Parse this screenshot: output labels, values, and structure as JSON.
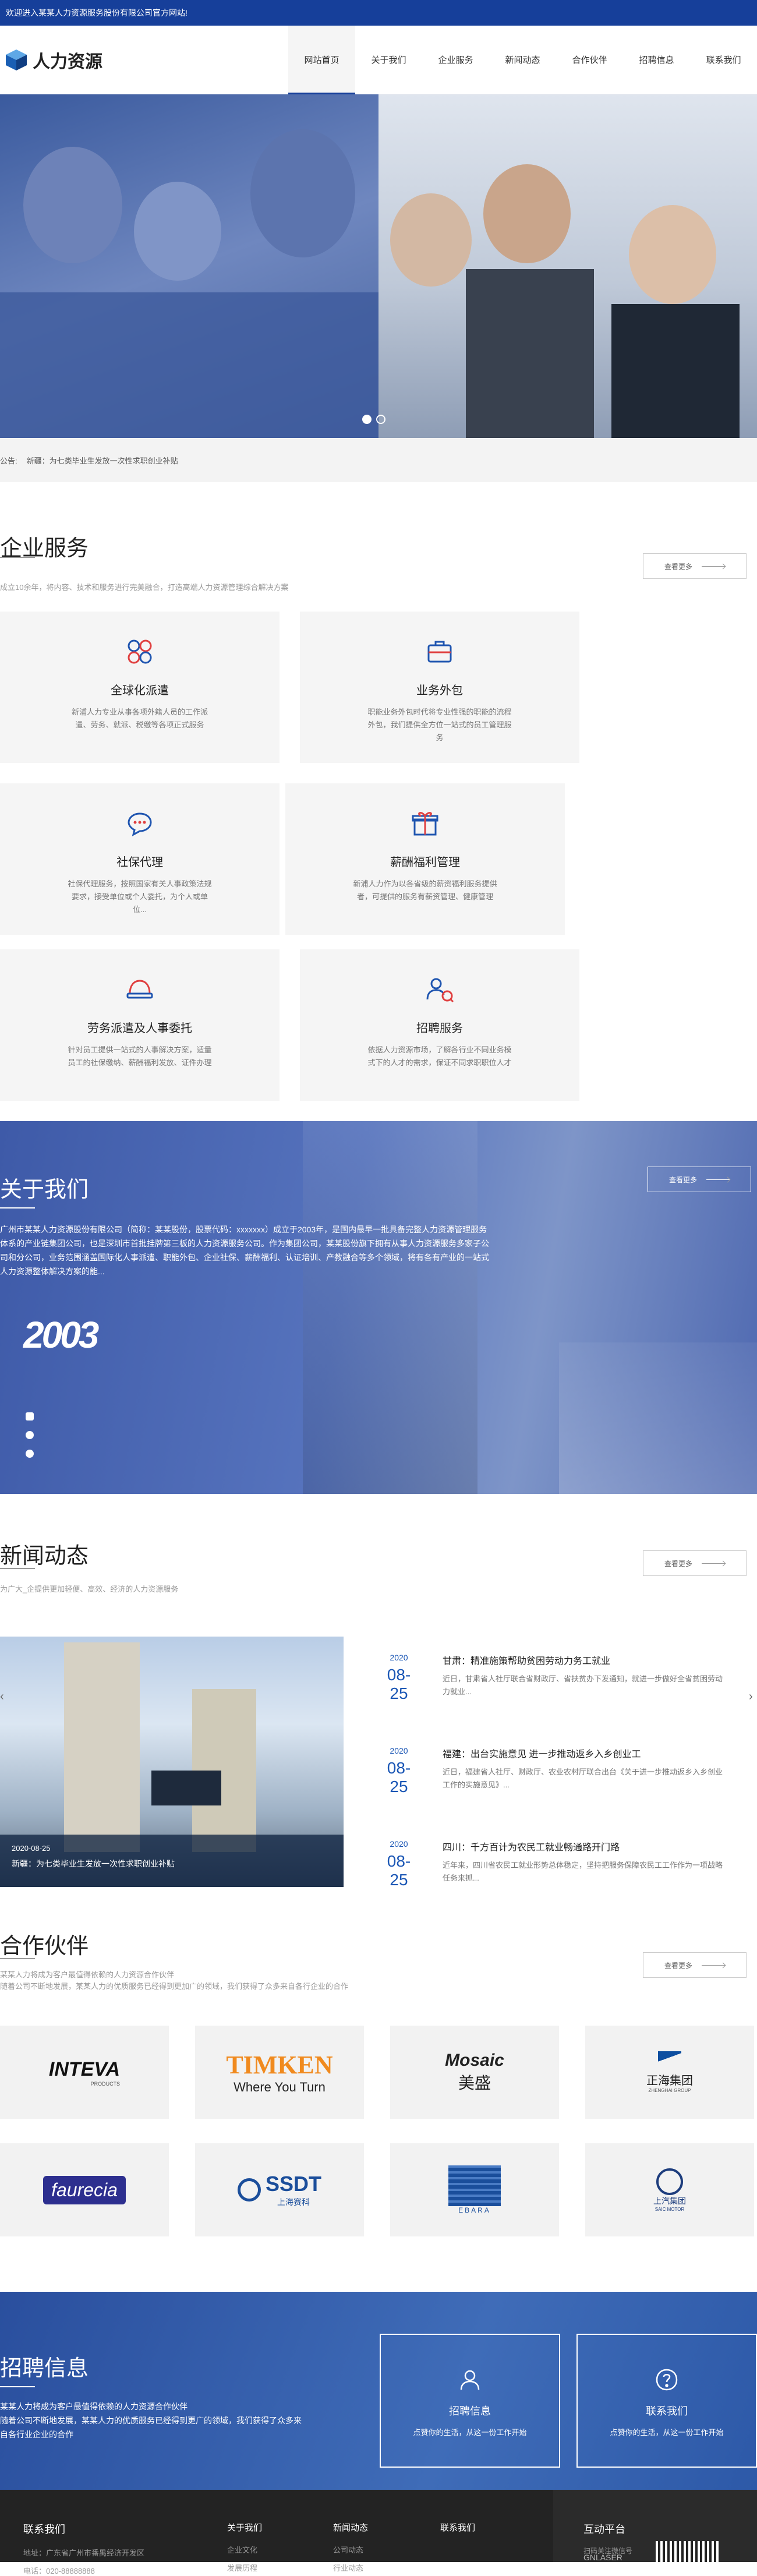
{
  "topbar": {
    "welcome": "欢迎进入某某人力资源服务股份有限公司官方网站!"
  },
  "header": {
    "logo_text": "人力资源",
    "nav": [
      "网站首页",
      "关于我们",
      "企业服务",
      "新闻动态",
      "合作伙伴",
      "招聘信息",
      "联系我们"
    ]
  },
  "notice": {
    "label": "公告:",
    "text": "新疆：为七类毕业生发放一次性求职创业补贴"
  },
  "services": {
    "title": "企业服务",
    "subtitle": "成立10余年，将内容、技术和服务进行完美融合，打造高端人力资源管理综合解决方案",
    "more": "查看更多",
    "cards": [
      {
        "title": "全球化派遣",
        "desc": "新浦人力专业从事各项外籍人员的工作派遣、劳务、就派、税缴等各项正式服务",
        "icon": "global-dispatch-icon"
      },
      {
        "title": "业务外包",
        "desc": "职能业务外包时代将专业性强的职能的流程外包，我们提供全方位一站式的员工管理服务",
        "icon": "briefcase-icon"
      },
      {
        "title": "社保代理",
        "desc": "社保代理服务，按照国家有关人事政策法规要求，接受单位或个人委托，为个人或单位...",
        "icon": "chat-bubble-icon"
      },
      {
        "title": "薪酬福利管理",
        "desc": "新浦人力作为以各省级的薪资福利服务提供者，可提供的服务有薪资管理、健康管理",
        "icon": "gift-icon"
      },
      {
        "title": "劳务派遣及人事委托",
        "desc": "针对员工提供一站式的人事解决方案，适量员工的社保缴纳、薪酬福利发放、证件办理",
        "icon": "helmet-icon"
      },
      {
        "title": "招聘服务",
        "desc": "依据人力资源市场，了解各行业不同业务模式下的人才的需求，保证不同求职职位人才",
        "icon": "recruit-people-icon"
      }
    ]
  },
  "about": {
    "title": "关于我们",
    "more": "查看更多",
    "text": "广州市某某人力资源股份有限公司（简称：某某股份，股票代码：xxxxxxx）成立于2003年，是国内最早一批具备完整人力资源管理服务体系的产业链集团公司，也是深圳市首批挂牌第三板的人力资源服务公司。作为集团公司，某某股份旗下拥有从事人力资源服务多家子公司和分公司，业务范围涵盖国际化人事派遣、职能外包、企业社保、薪酬福利、认证培训、产教融合等多个领域，将有各有产业的一站式人力资源整体解决方案的能...",
    "year": "2003"
  },
  "news": {
    "title": "新闻动态",
    "subtitle": "为广大_企提供更加轻便、高效、经济的人力资源服务",
    "more": "查看更多",
    "featured_caption_date": "2020-08-25",
    "featured_caption": "新疆：为七类毕业生发放一次性求职创业补贴",
    "items": [
      {
        "year": "2020",
        "day": "08-25",
        "title": "甘肃：精准施策帮助贫困劳动力务工就业",
        "desc": "近日，甘肃省人社厅联合省财政厅、省扶贫办下发通知，就进一步做好全省贫困劳动力就业..."
      },
      {
        "year": "2020",
        "day": "08-25",
        "title": "福建：出台实施意见 进一步推动返乡入乡创业工",
        "desc": "近日，福建省人社厅、财政厅、农业农村厅联合出台《关于进一步推动返乡入乡创业工作的实施意见》..."
      },
      {
        "year": "2020",
        "day": "08-25",
        "title": "四川：千方百计为农民工就业畅通路开门路",
        "desc": "近年来，四川省农民工就业形势总体稳定，坚持把服务保障农民工工作作为一项战略任务来抓..."
      }
    ]
  },
  "partners": {
    "title": "合作伙伴",
    "subtitle1": "某某人力将成为客户最值得依赖的人力资源合作伙伴",
    "subtitle2": "随着公司不断地发展，某某人力的优质服务已经得到更加广的领域，我们获得了众多来自各行企业的合作",
    "more": "查看更多",
    "logos": [
      {
        "main": "INTEVA",
        "sub": "PRODUCTS",
        "color": "#111111"
      },
      {
        "main": "TIMKEN",
        "sub": "Where You Turn",
        "color": "#f08a1e"
      },
      {
        "main": "Mosaic",
        "sub": "美盛",
        "color": "#333333"
      },
      {
        "main": "正海集团",
        "sub": "ZHENGHAI GROUP",
        "color": "#0d4ea0"
      },
      {
        "main": "faurecia",
        "sub": "",
        "color": "#2d2f8f"
      },
      {
        "main": "SSDT",
        "sub": "上海赛科",
        "color": "#1b4e9b"
      },
      {
        "main": "EBARA",
        "sub": "",
        "color": "#1a4e9b"
      },
      {
        "main": "上汽集团",
        "sub": "SAIC MOTOR",
        "color": "#1d3d7d"
      }
    ]
  },
  "recruit": {
    "title": "招聘信息",
    "text": "某某人力将成为客户最值得依赖的人力资源合作伙伴\n随着公司不断地发展，某某人力的优质服务已经得到更广的领域，我们获得了众多来自各行业企业的合作",
    "boxes": [
      {
        "title": "招聘信息",
        "sub": "点赞你的生活，从这一份工作开始"
      },
      {
        "title": "联系我们",
        "sub": "点赞你的生活，从这一份工作开始"
      }
    ]
  },
  "footer": {
    "contact_title": "联系我们",
    "address": "地址：广东省广州市番禺经济开发区",
    "phone": "电话：020-88888888",
    "cols": [
      {
        "title": "关于我们",
        "items": [
          "企业文化",
          "发展历程"
        ]
      },
      {
        "title": "新闻动态",
        "items": [
          "公司动态",
          "行业动态"
        ]
      },
      {
        "title": "联系我们",
        "items": []
      }
    ],
    "platform_title": "互动平台",
    "platform_sub": "扫码关注微信号",
    "platform_name": "GNLASER"
  }
}
